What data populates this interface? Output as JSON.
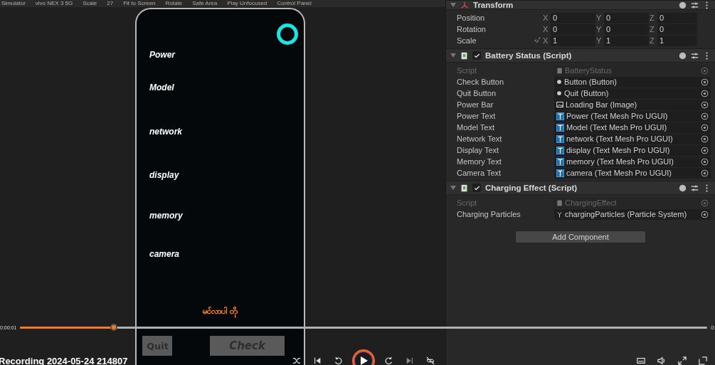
{
  "toolbar": {
    "items": [
      "Simulator",
      "vivo NEX 3 5G",
      "Scale",
      "27",
      "Fit to Screen",
      "Rotate",
      "Safe Area",
      "Play Unfocused",
      "Control Panel"
    ]
  },
  "game": {
    "labels": [
      "Power",
      "Model",
      "network",
      "display",
      "memory",
      "camera"
    ],
    "footer_text": "မင်လာပါ တို",
    "buttons": [
      {
        "label": "Quit"
      },
      {
        "label": "Check"
      }
    ]
  },
  "inspector": {
    "transform": {
      "title": "Transform",
      "rows": [
        {
          "label": "Position",
          "linked": false,
          "values": [
            {
              "axis": "X",
              "value": "0"
            },
            {
              "axis": "Y",
              "value": "0"
            },
            {
              "axis": "Z",
              "value": "0"
            }
          ]
        },
        {
          "label": "Rotation",
          "linked": false,
          "values": [
            {
              "axis": "X",
              "value": "0"
            },
            {
              "axis": "Y",
              "value": "0"
            },
            {
              "axis": "Z",
              "value": "0"
            }
          ]
        },
        {
          "label": "Scale",
          "linked": true,
          "values": [
            {
              "axis": "X",
              "value": "1"
            },
            {
              "axis": "Y",
              "value": "1"
            },
            {
              "axis": "Z",
              "value": "1"
            }
          ]
        }
      ]
    },
    "components": [
      {
        "title": "Battery Status (Script)",
        "enabled": true,
        "fields": [
          {
            "label": "Script",
            "value": "BatteryStatus",
            "kind": "script",
            "disabled": true
          },
          {
            "label": "Check Button",
            "value": "Button (Button)",
            "kind": "button",
            "disabled": false
          },
          {
            "label": "Quit Button",
            "value": "Quit (Button)",
            "kind": "button",
            "disabled": false
          },
          {
            "label": "Power Bar",
            "value": "Loading Bar (Image)",
            "kind": "image",
            "disabled": false
          },
          {
            "label": "Power Text",
            "value": "Power (Text Mesh Pro UGUI)",
            "kind": "text",
            "disabled": false
          },
          {
            "label": "Model Text",
            "value": "Model (Text Mesh Pro UGUI)",
            "kind": "text",
            "disabled": false
          },
          {
            "label": "Network Text",
            "value": "network (Text Mesh Pro UGUI)",
            "kind": "text",
            "disabled": false
          },
          {
            "label": "Display Text",
            "value": "display (Text Mesh Pro UGUI)",
            "kind": "text",
            "disabled": false
          },
          {
            "label": "Memory Text",
            "value": "memory (Text Mesh Pro UGUI)",
            "kind": "text",
            "disabled": false
          },
          {
            "label": "Camera Text",
            "value": "camera (Text Mesh Pro UGUI)",
            "kind": "text",
            "disabled": false
          }
        ]
      },
      {
        "title": "Charging Effect (Script)",
        "enabled": true,
        "fields": [
          {
            "label": "Script",
            "value": "ChargingEffect",
            "kind": "script",
            "disabled": true
          },
          {
            "label": "Charging Particles",
            "value": "chargingParticles (Particle System)",
            "kind": "particle",
            "disabled": false
          }
        ]
      }
    ],
    "add_button": "Add Component"
  },
  "player": {
    "elapsed": "0:00:01",
    "remaining": "0:",
    "progress": {
      "level": 0.136
    },
    "title": "Recording 2024-05-24 214807"
  }
}
